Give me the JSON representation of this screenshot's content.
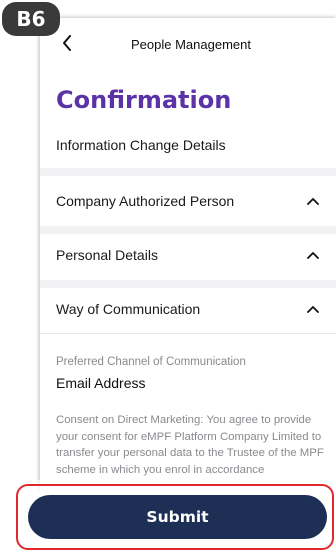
{
  "badge": {
    "label": "B6"
  },
  "topbar": {
    "title": "People Management",
    "back_icon": "chevron-left-icon"
  },
  "page": {
    "title": "Confirmation",
    "subheading": "Information Change Details"
  },
  "sections": [
    {
      "label": "Company Authorized Person",
      "icon": "chevron-up-icon",
      "expanded": true
    },
    {
      "label": "Personal Details",
      "icon": "chevron-up-icon",
      "expanded": true
    },
    {
      "label": "Way of Communication",
      "icon": "chevron-up-icon",
      "expanded": true
    }
  ],
  "communication": {
    "field_label": "Preferred Channel of Communication",
    "field_value": "Email Address",
    "consent_text": "Consent on Direct Marketing: You agree to provide your consent for eMPF Platform Company Limited to transfer your personal data to the Trustee of the MPF scheme in which you enrol in accordance"
  },
  "footer": {
    "submit_label": "Submit"
  },
  "colors": {
    "brand_purple": "#5b33a7",
    "button_navy": "#1d2f55",
    "highlight_red": "#e0282e",
    "badge_dark": "#3a3a3a"
  }
}
